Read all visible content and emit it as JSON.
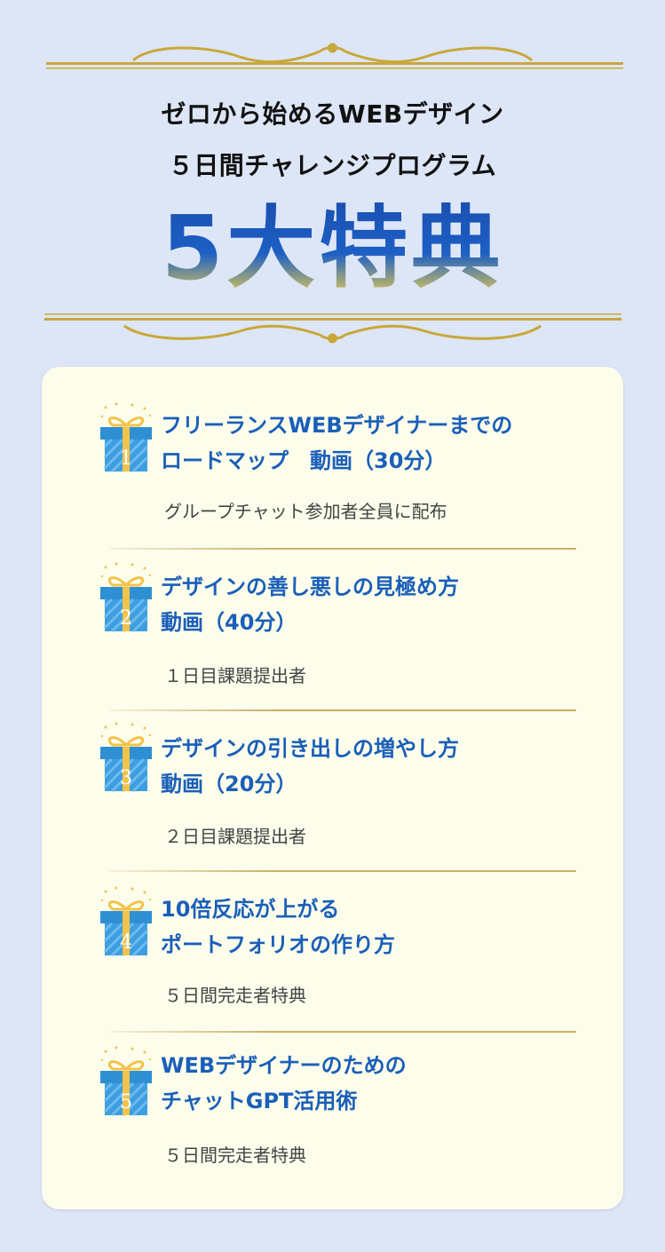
{
  "header": {
    "subtitle_line1": "ゼロから始めるWEBデザイン",
    "subtitle_line2": "５日間チャレンジプログラム",
    "hero_title": "5大特典"
  },
  "colors": {
    "background": "#dde6f7",
    "card": "#fdfdec",
    "title_blue": "#1a5fb8",
    "gold": "#c9a73a",
    "gift_blue": "#2f8fd3",
    "gift_ribbon": "#f2c34a"
  },
  "benefits": [
    {
      "number": "1",
      "title_line1": "フリーランスWEBデザイナーまでの",
      "title_line2": "ロードマップ　動画（30分）",
      "condition": "グループチャット参加者全員に配布"
    },
    {
      "number": "2",
      "title_line1": "デザインの善し悪しの見極め方",
      "title_line2": "動画（40分）",
      "condition": "１日目課題提出者"
    },
    {
      "number": "3",
      "title_line1": "デザインの引き出しの増やし方",
      "title_line2": "動画（20分）",
      "condition": "２日目課題提出者"
    },
    {
      "number": "4",
      "title_line1": "10倍反応が上がる",
      "title_line2": "ポートフォリオの作り方",
      "condition": "５日間完走者特典"
    },
    {
      "number": "5",
      "title_line1": "WEBデザイナーのための",
      "title_line2": "チャットGPT活用術",
      "condition": "５日間完走者特典"
    }
  ]
}
